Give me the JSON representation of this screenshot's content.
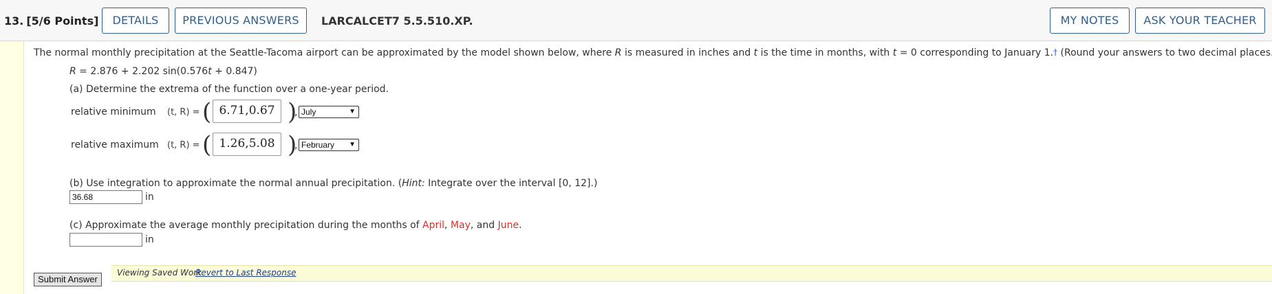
{
  "header": {
    "question_number": "13.",
    "points": "[5/6 Points]",
    "details_label": "DETAILS",
    "previous_answers_label": "PREVIOUS ANSWERS",
    "problem_code": "LARCALCET7 5.5.510.XP.",
    "my_notes_label": "MY NOTES",
    "ask_teacher_label": "ASK YOUR TEACHER"
  },
  "intro": {
    "part1": "The normal monthly precipitation at the Seattle-Tacoma airport can be approximated by the model shown below, where ",
    "var_R": "R",
    "part2": " is measured in inches and ",
    "var_t": "t",
    "part3": " is the time in months, with ",
    "var_t2": "t",
    "part4": " = 0 corresponding to January 1.",
    "dagger": "†",
    "part5": " (Round your answers to two decimal places.)"
  },
  "formula": {
    "lhs": "R",
    "eq": " = 2.876 + 2.202 sin(0.576",
    "t": "t",
    "rest": " + 0.847)"
  },
  "part_a": {
    "question": "(a) Determine the extrema of the function over a one-year period.",
    "rows": [
      {
        "label": "relative minimum",
        "tR": "(t, R) =",
        "answer": "6.71,0.67",
        "month": "July"
      },
      {
        "label": "relative maximum",
        "tR": "(t, R) =",
        "answer": "1.26,5.08",
        "month": "February"
      }
    ]
  },
  "part_b": {
    "q1": "(b) Use integration to approximate the normal annual precipitation. (",
    "hint": "Hint:",
    "q2": " Integrate over the interval [0, 12].)",
    "value": "36.68",
    "unit": "in"
  },
  "part_c": {
    "q1": "(c) Approximate the average monthly precipitation during the months of ",
    "m1": "April",
    "sep1": ", ",
    "m2": "May",
    "sep2": ", and ",
    "m3": "June",
    "end": ".",
    "value": "",
    "unit": "in"
  },
  "footer": {
    "submit_label": "Submit Answer",
    "status_text": "Viewing Saved Work",
    "revert_link": "Revert to Last Response"
  },
  "colors": {
    "accent_blue": "#2f5f8a",
    "highlight_red": "#d9302c",
    "status_yellow": "#fbfbd7"
  }
}
